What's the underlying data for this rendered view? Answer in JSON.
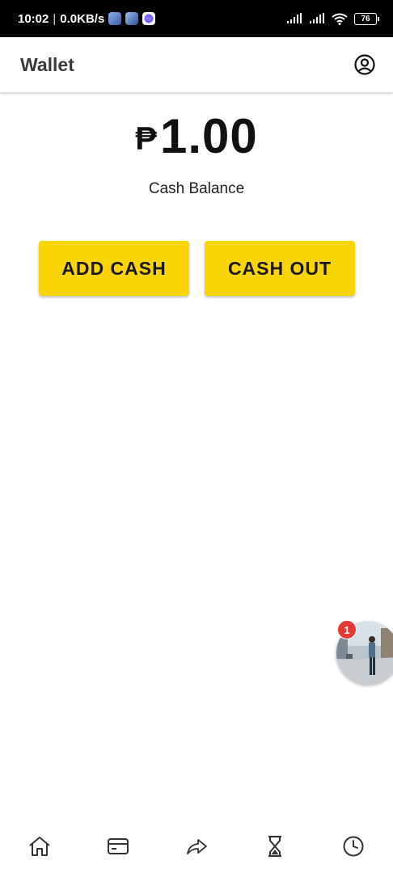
{
  "status_bar": {
    "time": "10:02",
    "network_speed": "0.0KB/s",
    "battery": "76",
    "notification_icons": [
      "app-notification-icon",
      "app-notification-icon",
      "messenger-icon"
    ],
    "system_icons": [
      "signal-icon",
      "signal-icon",
      "wifi-icon",
      "battery-icon"
    ]
  },
  "app_bar": {
    "title": "Wallet",
    "profile_icon": "account-circle-icon"
  },
  "balance": {
    "currency_symbol": "₱",
    "amount": "1.00",
    "label": "Cash Balance"
  },
  "actions": {
    "add_cash": "ADD CASH",
    "cash_out": "CASH OUT"
  },
  "chat_head": {
    "badge_count": "1"
  },
  "bottom_nav": {
    "items": [
      {
        "icon": "home-icon"
      },
      {
        "icon": "card-icon"
      },
      {
        "icon": "share-arrow-icon"
      },
      {
        "icon": "hourglass-icon"
      },
      {
        "icon": "clock-icon"
      }
    ]
  },
  "colors": {
    "accent": "#f9d407",
    "status_bar": "#000000",
    "badge": "#e53935"
  }
}
